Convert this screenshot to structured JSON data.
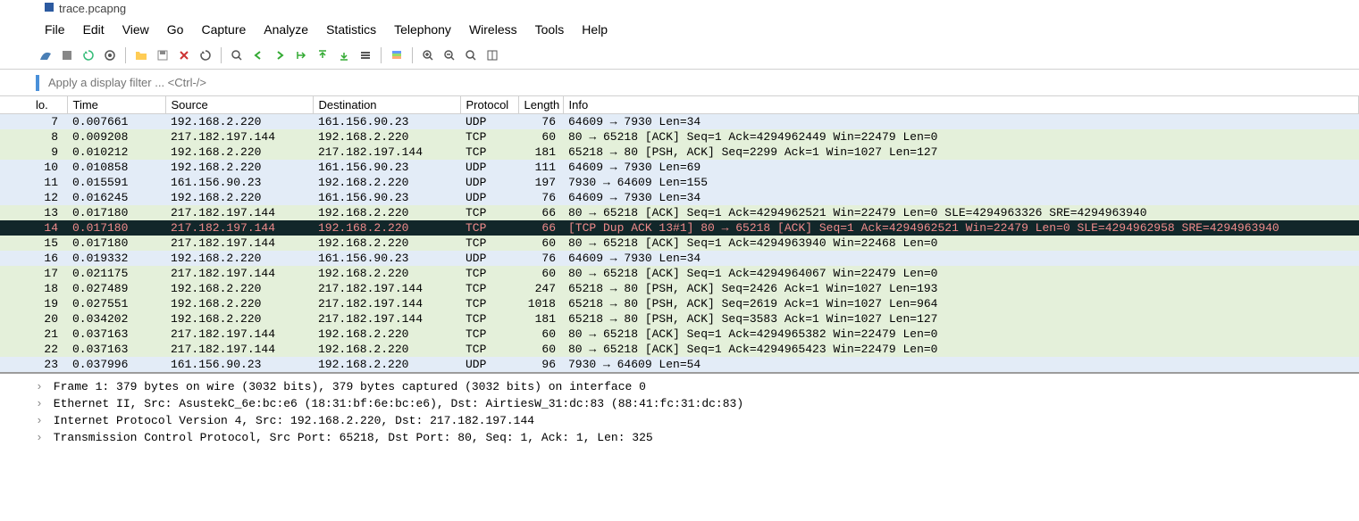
{
  "title": "trace.pcapng",
  "menu": [
    "File",
    "Edit",
    "View",
    "Go",
    "Capture",
    "Analyze",
    "Statistics",
    "Telephony",
    "Wireless",
    "Tools",
    "Help"
  ],
  "filter_placeholder": "Apply a display filter ... <Ctrl-/>",
  "columns": [
    "lo.",
    "Time",
    "Source",
    "Destination",
    "Protocol",
    "Length",
    "Info"
  ],
  "packets": [
    {
      "no": "7",
      "time": "0.007661",
      "src": "192.168.2.220",
      "dst": "161.156.90.23",
      "proto": "UDP",
      "len": "76",
      "info": "64609 → 7930 Len=34",
      "cls": "udp"
    },
    {
      "no": "8",
      "time": "0.009208",
      "src": "217.182.197.144",
      "dst": "192.168.2.220",
      "proto": "TCP",
      "len": "60",
      "info": "80 → 65218 [ACK] Seq=1 Ack=4294962449 Win=22479 Len=0",
      "cls": "tcp"
    },
    {
      "no": "9",
      "time": "0.010212",
      "src": "192.168.2.220",
      "dst": "217.182.197.144",
      "proto": "TCP",
      "len": "181",
      "info": "65218 → 80 [PSH, ACK] Seq=2299 Ack=1 Win=1027 Len=127",
      "cls": "tcp"
    },
    {
      "no": "10",
      "time": "0.010858",
      "src": "192.168.2.220",
      "dst": "161.156.90.23",
      "proto": "UDP",
      "len": "111",
      "info": "64609 → 7930 Len=69",
      "cls": "udp"
    },
    {
      "no": "11",
      "time": "0.015591",
      "src": "161.156.90.23",
      "dst": "192.168.2.220",
      "proto": "UDP",
      "len": "197",
      "info": "7930 → 64609 Len=155",
      "cls": "udp"
    },
    {
      "no": "12",
      "time": "0.016245",
      "src": "192.168.2.220",
      "dst": "161.156.90.23",
      "proto": "UDP",
      "len": "76",
      "info": "64609 → 7930 Len=34",
      "cls": "udp"
    },
    {
      "no": "13",
      "time": "0.017180",
      "src": "217.182.197.144",
      "dst": "192.168.2.220",
      "proto": "TCP",
      "len": "66",
      "info": "80 → 65218 [ACK] Seq=1 Ack=4294962521 Win=22479 Len=0 SLE=4294963326 SRE=4294963940",
      "cls": "tcp"
    },
    {
      "no": "14",
      "time": "0.017180",
      "src": "217.182.197.144",
      "dst": "192.168.2.220",
      "proto": "TCP",
      "len": "66",
      "info": "[TCP Dup ACK 13#1] 80 → 65218 [ACK] Seq=1 Ack=4294962521 Win=22479 Len=0 SLE=4294962958 SRE=4294963940",
      "cls": "sel"
    },
    {
      "no": "15",
      "time": "0.017180",
      "src": "217.182.197.144",
      "dst": "192.168.2.220",
      "proto": "TCP",
      "len": "60",
      "info": "80 → 65218 [ACK] Seq=1 Ack=4294963940 Win=22468 Len=0",
      "cls": "tcp"
    },
    {
      "no": "16",
      "time": "0.019332",
      "src": "192.168.2.220",
      "dst": "161.156.90.23",
      "proto": "UDP",
      "len": "76",
      "info": "64609 → 7930 Len=34",
      "cls": "udp"
    },
    {
      "no": "17",
      "time": "0.021175",
      "src": "217.182.197.144",
      "dst": "192.168.2.220",
      "proto": "TCP",
      "len": "60",
      "info": "80 → 65218 [ACK] Seq=1 Ack=4294964067 Win=22479 Len=0",
      "cls": "tcp"
    },
    {
      "no": "18",
      "time": "0.027489",
      "src": "192.168.2.220",
      "dst": "217.182.197.144",
      "proto": "TCP",
      "len": "247",
      "info": "65218 → 80 [PSH, ACK] Seq=2426 Ack=1 Win=1027 Len=193",
      "cls": "tcp"
    },
    {
      "no": "19",
      "time": "0.027551",
      "src": "192.168.2.220",
      "dst": "217.182.197.144",
      "proto": "TCP",
      "len": "1018",
      "info": "65218 → 80 [PSH, ACK] Seq=2619 Ack=1 Win=1027 Len=964",
      "cls": "tcp"
    },
    {
      "no": "20",
      "time": "0.034202",
      "src": "192.168.2.220",
      "dst": "217.182.197.144",
      "proto": "TCP",
      "len": "181",
      "info": "65218 → 80 [PSH, ACK] Seq=3583 Ack=1 Win=1027 Len=127",
      "cls": "tcp"
    },
    {
      "no": "21",
      "time": "0.037163",
      "src": "217.182.197.144",
      "dst": "192.168.2.220",
      "proto": "TCP",
      "len": "60",
      "info": "80 → 65218 [ACK] Seq=1 Ack=4294965382 Win=22479 Len=0",
      "cls": "tcp"
    },
    {
      "no": "22",
      "time": "0.037163",
      "src": "217.182.197.144",
      "dst": "192.168.2.220",
      "proto": "TCP",
      "len": "60",
      "info": "80 → 65218 [ACK] Seq=1 Ack=4294965423 Win=22479 Len=0",
      "cls": "tcp"
    },
    {
      "no": "23",
      "time": "0.037996",
      "src": "161.156.90.23",
      "dst": "192.168.2.220",
      "proto": "UDP",
      "len": "96",
      "info": "7930 → 64609 Len=54",
      "cls": "udp"
    }
  ],
  "details": [
    "Frame 1: 379 bytes on wire (3032 bits), 379 bytes captured (3032 bits) on interface 0",
    "Ethernet II, Src: AsustekC_6e:bc:e6 (18:31:bf:6e:bc:e6), Dst: AirtiesW_31:dc:83 (88:41:fc:31:dc:83)",
    "Internet Protocol Version 4, Src: 192.168.2.220, Dst: 217.182.197.144",
    "Transmission Control Protocol, Src Port: 65218, Dst Port: 80, Seq: 1, Ack: 1, Len: 325"
  ]
}
